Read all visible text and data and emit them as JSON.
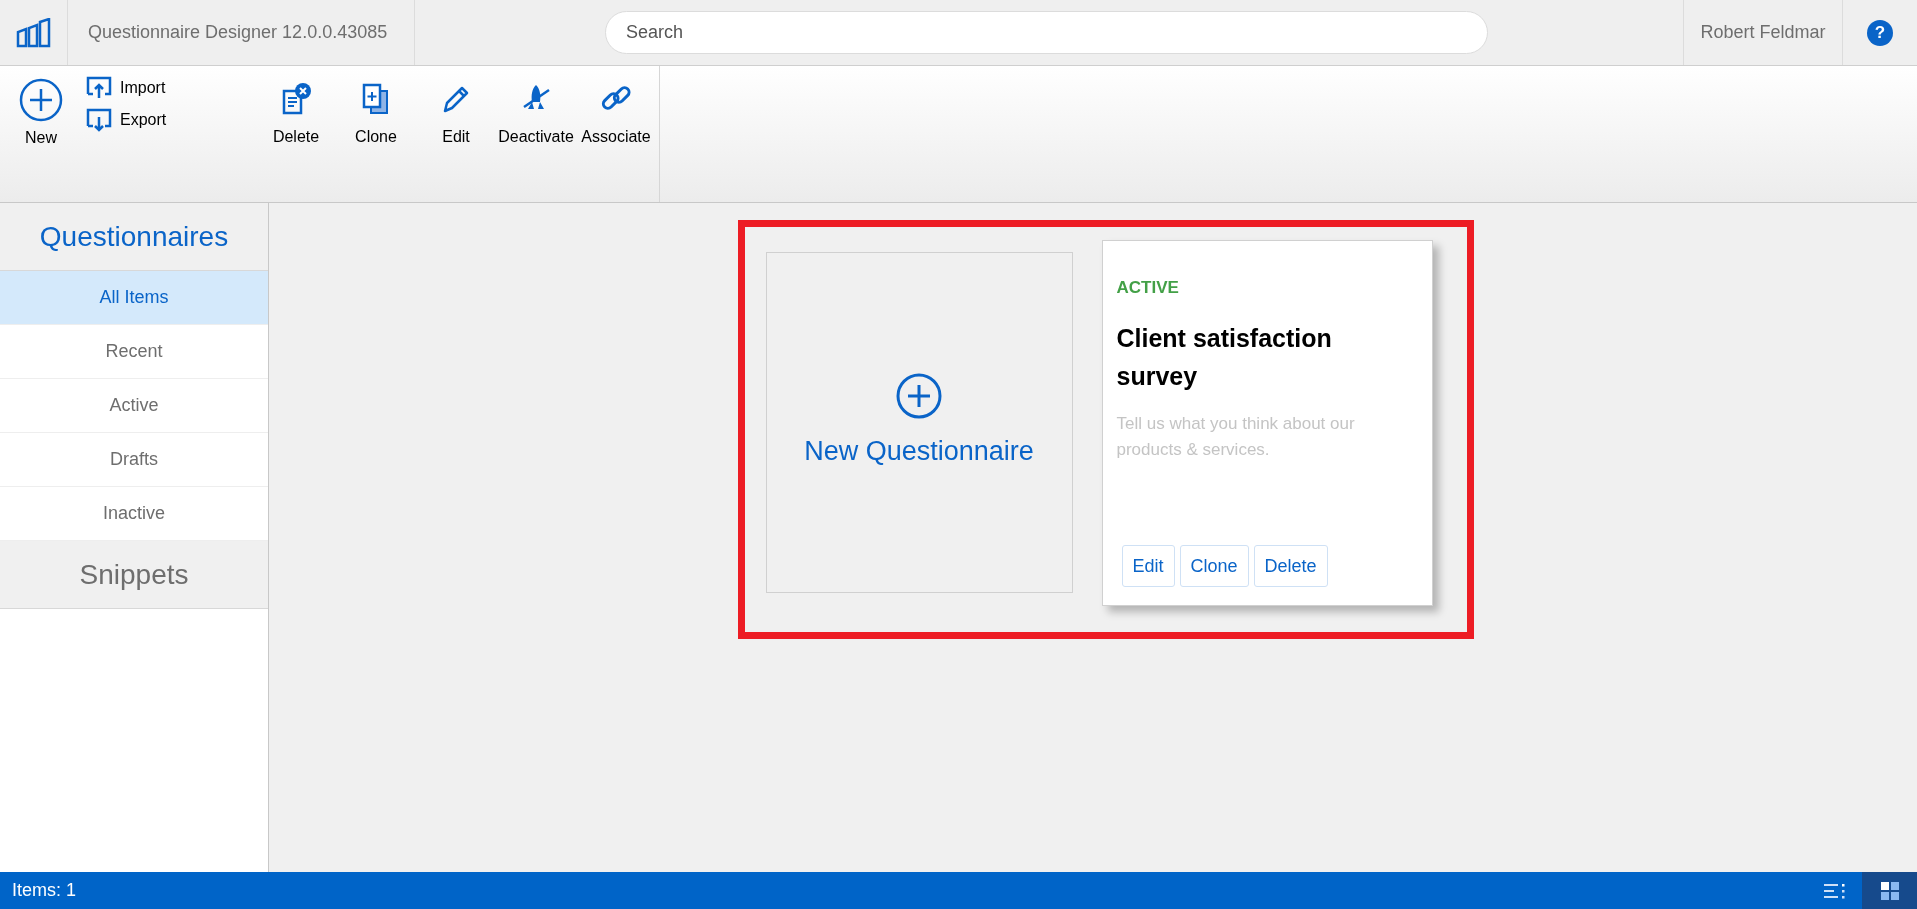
{
  "app": {
    "title": "Questionnaire Designer 12.0.0.43085"
  },
  "search": {
    "placeholder": "Search"
  },
  "user": {
    "name": "Robert Feldmar"
  },
  "help": {
    "label": "?"
  },
  "toolbar": {
    "new": "New",
    "import": "Import",
    "export": "Export",
    "actions": [
      {
        "kind": "delete",
        "label": "Delete"
      },
      {
        "kind": "clone",
        "label": "Clone"
      },
      {
        "kind": "edit",
        "label": "Edit"
      },
      {
        "kind": "deactivate",
        "label": "Deactivate"
      },
      {
        "kind": "associate",
        "label": "Associate"
      }
    ]
  },
  "sidebar": {
    "sections": [
      {
        "title": "Questionnaires",
        "active": true,
        "items": [
          {
            "label": "All Items",
            "selected": true
          },
          {
            "label": "Recent",
            "selected": false
          },
          {
            "label": "Active",
            "selected": false
          },
          {
            "label": "Drafts",
            "selected": false
          },
          {
            "label": "Inactive",
            "selected": false
          }
        ]
      },
      {
        "title": "Snippets",
        "active": false
      }
    ]
  },
  "new_card": {
    "label": "New Questionnaire"
  },
  "cards": [
    {
      "status": "ACTIVE",
      "title": "Client satisfaction survey",
      "description": "Tell us what you think about our products & services.",
      "buttons": [
        "Edit",
        "Clone",
        "Delete"
      ]
    }
  ],
  "status_bar": {
    "text": "Items: 1",
    "views": [
      {
        "kind": "list",
        "selected": false
      },
      {
        "kind": "tiles",
        "selected": true
      }
    ]
  }
}
